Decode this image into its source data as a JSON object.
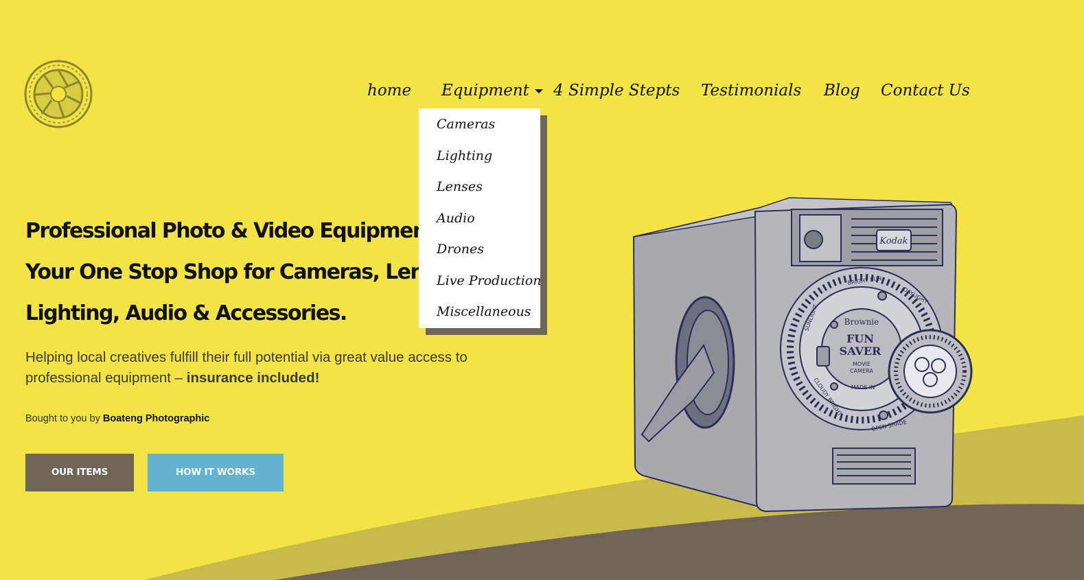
{
  "colors": {
    "background": "#f2e445",
    "wave_light": "#c9bb4a",
    "wave_dark": "#6e6557",
    "button_primary": "#6e6557",
    "button_secondary": "#62b3d0",
    "dropdown_bg": "#ffffff"
  },
  "logo": {
    "icon": "camera-aperture-icon"
  },
  "nav": {
    "home": "home",
    "equipment": "Equipment",
    "steps": "4 Simple Stepts",
    "testimonials": "Testimonials",
    "blog": "Blog",
    "contact": "Contact Us",
    "equipment_menu": [
      "Cameras",
      "Lighting",
      "Lenses",
      "Audio",
      "Drones",
      "Live Production",
      "Miscellaneous"
    ]
  },
  "hero": {
    "title_lines": [
      "Professional Photo & Video Equipment Rental.",
      "Your One Stop Shop for Cameras, Lenses,",
      "Lighting, Audio & Accessories."
    ],
    "subtitle": "Helping local creatives fulfill their full potential via great value access to professional equipment – ",
    "subtitle_bold": "insurance included!",
    "brought_prefix": "Bought to you by ",
    "brought_brand": "Boateng Photographic"
  },
  "buttons": {
    "our_items": "OUR ITEMS",
    "how_it_works": "HOW IT WORKS"
  },
  "camera_image": {
    "brand": "Kodak",
    "model_line1": "Brownie",
    "model_line2": "FUN",
    "model_line3": "SAVER",
    "model_line4": "MOVIE",
    "model_line5": "CAMERA",
    "made_in": "MADE IN",
    "dial_top": "BRIGHT SUN",
    "dial_right": "DAYLIGHT",
    "dial_left": "SUNLIGHT",
    "dial_bottom_left": "CLOUDY BRIGHT",
    "dial_bottom": "OPEN SHADE"
  }
}
